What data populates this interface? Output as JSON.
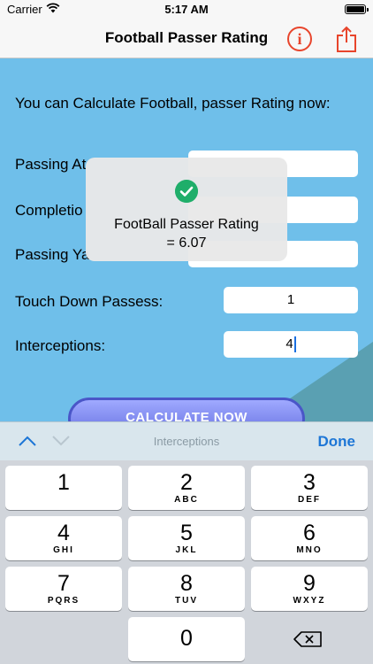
{
  "status_bar": {
    "carrier": "Carrier",
    "time": "5:17 AM"
  },
  "nav": {
    "title": "Football Passer Rating",
    "info_glyph": "i"
  },
  "content": {
    "headline": "You can Calculate Football, passer Rating now:",
    "fields": {
      "passing_attempts_label": "Passing At",
      "completions_label": "Completio",
      "passing_yards_label": "Passing Ya",
      "touchdowns_label": "Touch Down Passess:",
      "touchdowns_value": "1",
      "interceptions_label": "Interceptions:",
      "interceptions_value": "4"
    },
    "calculate_button": "CALCULATE NOW"
  },
  "toast": {
    "line1": "FootBall Passer Rating",
    "line2": "= 6.07"
  },
  "accessory": {
    "title": "Interceptions",
    "done": "Done"
  },
  "keypad": {
    "keys": [
      {
        "digit": "1",
        "letters": ""
      },
      {
        "digit": "2",
        "letters": "ABC"
      },
      {
        "digit": "3",
        "letters": "DEF"
      },
      {
        "digit": "4",
        "letters": "GHI"
      },
      {
        "digit": "5",
        "letters": "JKL"
      },
      {
        "digit": "6",
        "letters": "MNO"
      },
      {
        "digit": "7",
        "letters": "PQRS"
      },
      {
        "digit": "8",
        "letters": "TUV"
      },
      {
        "digit": "9",
        "letters": "WXYZ"
      },
      {
        "digit": "0",
        "letters": ""
      }
    ]
  },
  "colors": {
    "background_blue": "#6fbfea",
    "accent_red": "#e8452c",
    "done_blue": "#1d76d6",
    "success_green": "#1fae6a"
  },
  "icons": [
    "wifi-icon",
    "battery-icon",
    "info-icon",
    "share-icon",
    "check-icon",
    "chevron-up-icon",
    "chevron-down-icon",
    "delete-key-icon"
  ]
}
